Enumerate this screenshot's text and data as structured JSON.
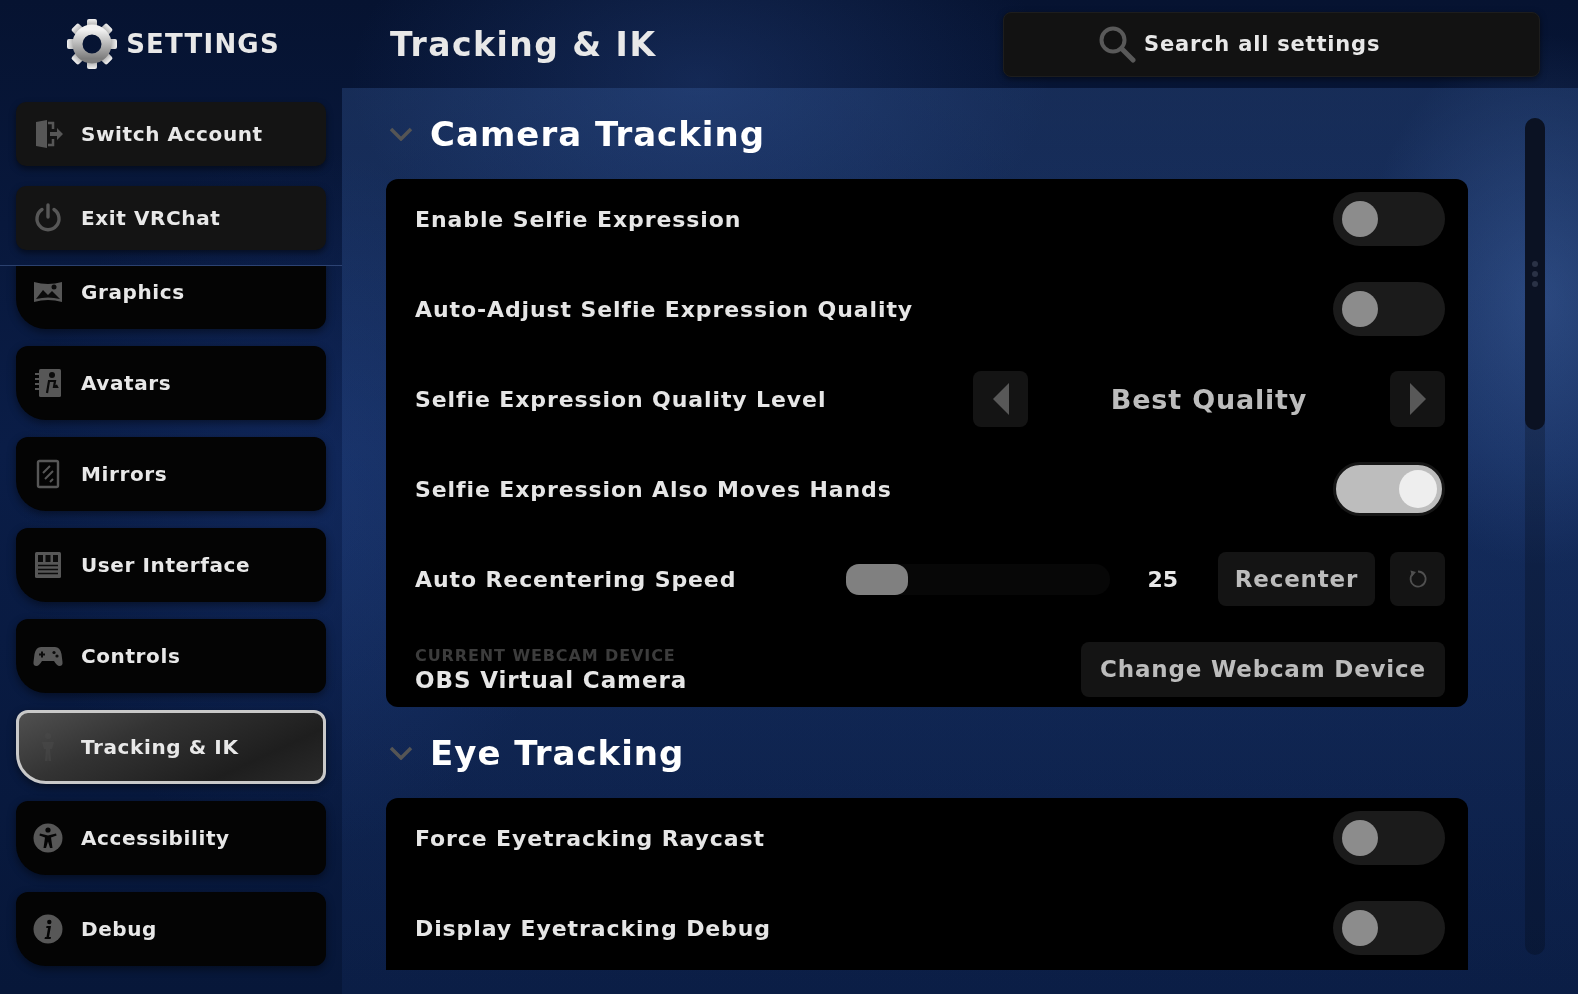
{
  "header": {
    "title": "SETTINGS",
    "page_title": "Tracking & IK"
  },
  "search": {
    "placeholder": "Search all settings"
  },
  "sidebar": {
    "actions": [
      {
        "label": "Switch Account"
      },
      {
        "label": "Exit VRChat"
      }
    ],
    "items": [
      {
        "label": "Graphics",
        "selected": false
      },
      {
        "label": "Avatars",
        "selected": false
      },
      {
        "label": "Mirrors",
        "selected": false
      },
      {
        "label": "User Interface",
        "selected": false
      },
      {
        "label": "Controls",
        "selected": false
      },
      {
        "label": "Tracking & IK",
        "selected": true
      },
      {
        "label": "Accessibility",
        "selected": false
      },
      {
        "label": "Debug",
        "selected": false
      }
    ]
  },
  "sections": [
    {
      "title": "Camera Tracking",
      "expanded": true,
      "settings": [
        {
          "kind": "toggle",
          "label": "Enable Selfie Expression",
          "on": false
        },
        {
          "kind": "toggle",
          "label": "Auto-Adjust Selfie Expression Quality",
          "on": false
        },
        {
          "kind": "selector",
          "label": "Selfie Expression Quality Level",
          "value": "Best Quality"
        },
        {
          "kind": "toggle",
          "label": "Selfie Expression Also Moves Hands",
          "on": true
        },
        {
          "kind": "slider",
          "label": "Auto Recentering Speed",
          "level": 0,
          "reading": "25",
          "button": "Recenter"
        },
        {
          "kind": "device",
          "caption": "CURRENT WEBCAM DEVICE",
          "value": "OBS Virtual Camera",
          "button": "Change Webcam Device"
        }
      ]
    },
    {
      "title": "Eye Tracking",
      "expanded": true,
      "settings": [
        {
          "kind": "toggle",
          "label": "Force Eyetracking Raycast",
          "on": false
        },
        {
          "kind": "toggle",
          "label": "Display Eyetracking Debug",
          "on": false
        }
      ]
    }
  ]
}
